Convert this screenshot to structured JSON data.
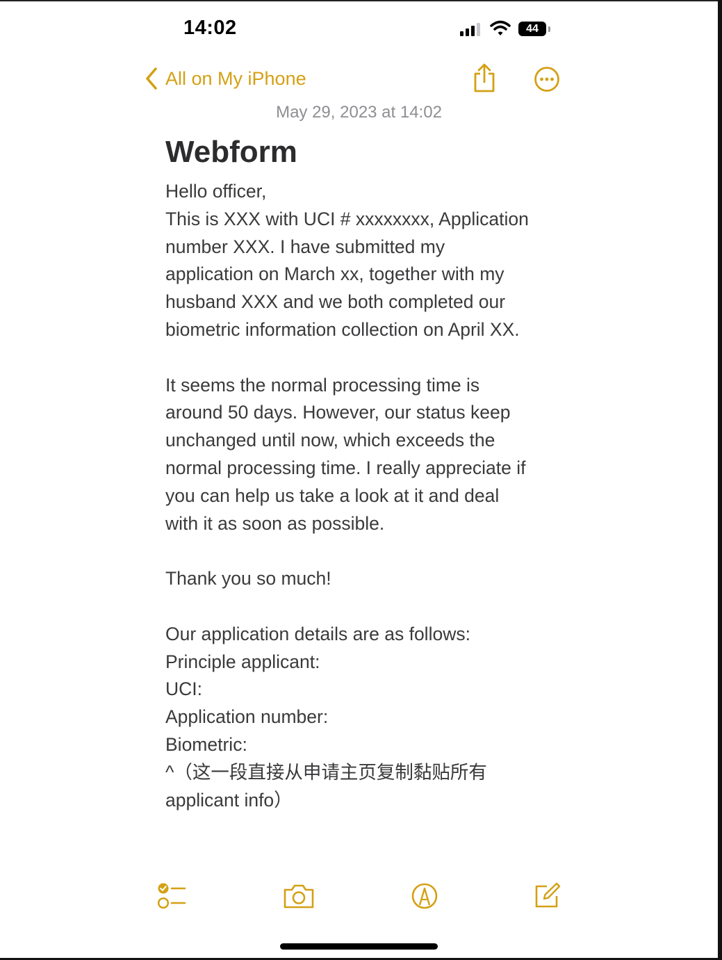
{
  "status_bar": {
    "time": "14:02",
    "battery": "44"
  },
  "nav": {
    "back_label": "All on My iPhone"
  },
  "note": {
    "date": "May 29, 2023 at 14:02",
    "title": "Webform",
    "lines": [
      "Hello officer,",
      "This is XXX with UCI # xxxxxxxx, Application",
      "number XXX. I have submitted my",
      "application on March xx, together with my",
      "husband XXX and we both completed our",
      "biometric information collection on April XX.",
      "",
      "It seems the normal processing time is",
      "around 50 days. However, our status keep",
      "unchanged until now, which exceeds the",
      "normal processing time. I really appreciate if",
      "you can help us take a look at it and deal",
      "with it as soon as possible.",
      "",
      "Thank you so much!",
      "",
      "Our application details are as follows:",
      "Principle applicant:",
      "UCI:",
      "Application number:",
      "Biometric:",
      "^（这一段直接从申请主页复制黏贴所有",
      "applicant info）"
    ]
  },
  "colors": {
    "accent": "#d4a014",
    "date_text": "#8e8e93",
    "body_text": "#3a3a3c"
  },
  "icons": {
    "back": "chevron-left-icon",
    "share": "share-icon",
    "more": "ellipsis-circle-icon",
    "checklist": "checklist-icon",
    "camera": "camera-icon",
    "markup": "markup-pen-icon",
    "compose": "compose-icon"
  }
}
